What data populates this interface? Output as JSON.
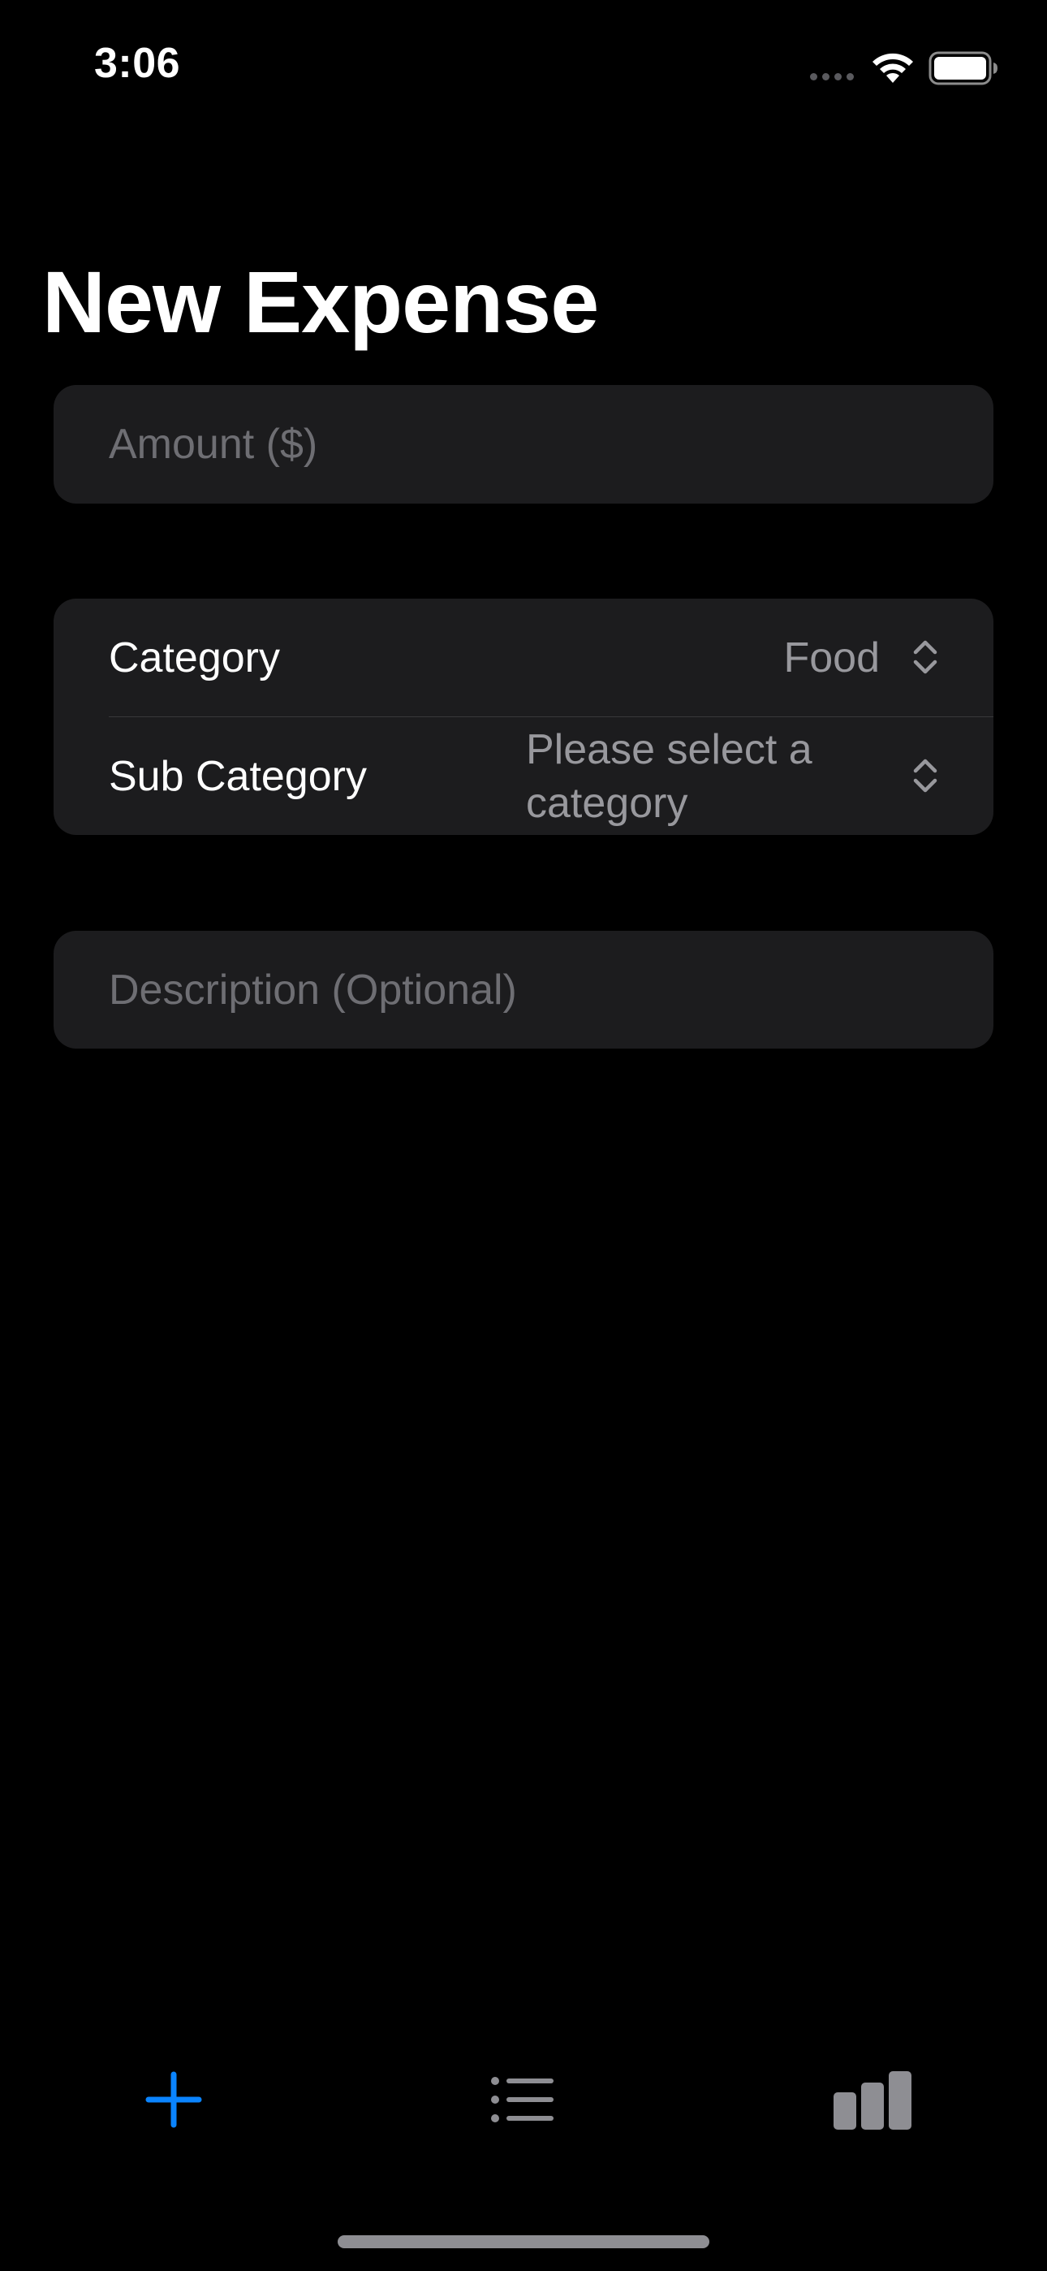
{
  "status_bar": {
    "time": "3:06",
    "wifi_icon": "wifi-icon",
    "battery_icon": "battery-icon"
  },
  "page": {
    "title": "New Expense"
  },
  "form": {
    "amount": {
      "placeholder": "Amount ($)",
      "value": ""
    },
    "category": {
      "label": "Category",
      "value": "Food",
      "icon": "chevron-updown-icon"
    },
    "sub_category": {
      "label": "Sub Category",
      "value": "Please select a category",
      "icon": "chevron-updown-icon"
    },
    "description": {
      "placeholder": "Description (Optional)",
      "value": ""
    }
  },
  "tab_bar": {
    "tabs": [
      {
        "icon": "plus-icon",
        "selected": true
      },
      {
        "icon": "list-icon",
        "selected": false
      },
      {
        "icon": "bar-chart-icon",
        "selected": false
      }
    ]
  },
  "colors": {
    "background": "#000000",
    "group_background": "#1c1c1e",
    "accent": "#0a84ff",
    "placeholder": "#6e6e73",
    "secondary_text": "#98989d",
    "inactive_icon": "#8e8e93"
  }
}
